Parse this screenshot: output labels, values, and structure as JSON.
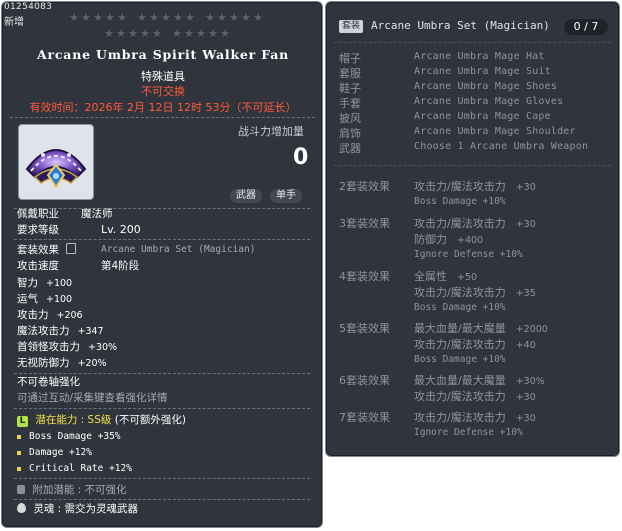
{
  "item": {
    "id": "01254083",
    "new_tag": "新增",
    "star_rows": [
      15,
      10
    ],
    "name": "Arcane Umbra Spirit Walker Fan",
    "category": "特殊道具",
    "untradeable": "不可交换",
    "expiry": "有效时间：2026年 2月 12日 12时 53分（不可延长）",
    "combat_power_label": "战斗力增加量",
    "combat_power_value": "0",
    "tags": [
      "武器",
      "单手"
    ],
    "job_label": "佩戴职业",
    "job_value": "魔法师",
    "level_label": "要求等级",
    "level_value": "Lv. 200",
    "set_label": "套装效果",
    "set_value": "Arcane Umbra Set (Magician)",
    "attack_speed_label": "攻击速度",
    "attack_speed_value": "第4阶段",
    "stats": [
      {
        "label": "智力",
        "value": "+100"
      },
      {
        "label": "运气",
        "value": "+100"
      },
      {
        "label": "攻击力",
        "value": "+206"
      },
      {
        "label": "魔法攻击力",
        "value": "+347"
      },
      {
        "label": "首领怪攻击力",
        "value": "+30%"
      },
      {
        "label": "无视防御力",
        "value": "+20%"
      }
    ],
    "no_scroll": "不可卷轴强化",
    "scroll_hint": "可通过互动/采集键查看强化详情",
    "potential_icon": "L",
    "potential_label": "潜在能力 : SS级",
    "potential_note": "(不可额外强化)",
    "potential_lines": [
      "Boss Damage +35%",
      "Damage +12%",
      "Critical Rate +12%"
    ],
    "additional_label": "附加潜能 : 不可强化",
    "soul_label": "灵魂 : 需交为灵魂武器"
  },
  "set": {
    "badge": "套装",
    "title": "Arcane Umbra Set (Magician)",
    "count": "0 / 7",
    "pieces": [
      {
        "slot": "帽子",
        "name": "Arcane Umbra Mage Hat"
      },
      {
        "slot": "套服",
        "name": "Arcane Umbra Mage Suit"
      },
      {
        "slot": "鞋子",
        "name": "Arcane Umbra Mage Shoes"
      },
      {
        "slot": "手套",
        "name": "Arcane Umbra Mage Gloves"
      },
      {
        "slot": "披风",
        "name": "Arcane Umbra Mage Cape"
      },
      {
        "slot": "肩饰",
        "name": "Arcane Umbra Mage Shoulder"
      },
      {
        "slot": "武器",
        "name": "Choose 1 Arcane Umbra Weapon"
      }
    ],
    "bonuses": [
      {
        "label": "2套装效果",
        "lines": [
          {
            "text": "攻击力/魔法攻击力",
            "value": "+30"
          },
          {
            "text": "Boss Damage +10%",
            "value": ""
          }
        ]
      },
      {
        "label": "3套装效果",
        "lines": [
          {
            "text": "攻击力/魔法攻击力",
            "value": "+30"
          },
          {
            "text": "防御力",
            "value": "+400"
          },
          {
            "text": "Ignore Defense +10%",
            "value": ""
          }
        ]
      },
      {
        "label": "4套装效果",
        "lines": [
          {
            "text": "全属性",
            "value": "+50"
          },
          {
            "text": "攻击力/魔法攻击力",
            "value": "+35"
          },
          {
            "text": "Boss Damage +10%",
            "value": ""
          }
        ]
      },
      {
        "label": "5套装效果",
        "lines": [
          {
            "text": "最大血量/最大魔量",
            "value": "+2000"
          },
          {
            "text": "攻击力/魔法攻击力",
            "value": "+40"
          },
          {
            "text": "Boss Damage +10%",
            "value": ""
          }
        ]
      },
      {
        "label": "6套装效果",
        "lines": [
          {
            "text": "最大血量/最大魔量",
            "value": "+30%"
          },
          {
            "text": "攻击力/魔法攻击力",
            "value": "+30"
          }
        ]
      },
      {
        "label": "7套装效果",
        "lines": [
          {
            "text": "攻击力/魔法攻击力",
            "value": "+30"
          },
          {
            "text": "Ignore Defense +10%",
            "value": ""
          }
        ]
      }
    ]
  }
}
